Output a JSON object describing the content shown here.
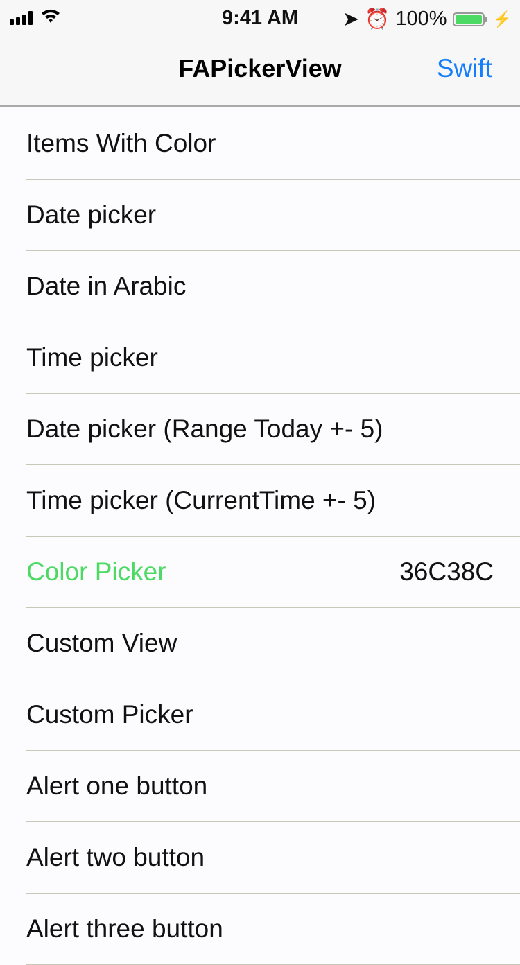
{
  "status_bar": {
    "time": "9:41 AM",
    "battery": "100%",
    "battery_level": 1.0,
    "icons": [
      "signal-icon",
      "wifi-icon",
      "location-icon",
      "alarm-icon",
      "battery-icon",
      "charging-icon"
    ]
  },
  "nav": {
    "title": "FAPickerView",
    "right_button": "Swift"
  },
  "colors": {
    "accent": "#147efb",
    "selected": "#4cd964"
  },
  "rows": [
    {
      "label": "Items With Color",
      "value": ""
    },
    {
      "label": "Date picker",
      "value": ""
    },
    {
      "label": "Date in Arabic",
      "value": ""
    },
    {
      "label": "Time picker",
      "value": ""
    },
    {
      "label": "Date picker (Range Today +- 5)",
      "value": ""
    },
    {
      "label": "Time picker (CurrentTime +- 5)",
      "value": ""
    },
    {
      "label": "Color Picker",
      "value": "36C38C"
    },
    {
      "label": "Custom View",
      "value": ""
    },
    {
      "label": "Custom Picker",
      "value": ""
    },
    {
      "label": "Alert one button",
      "value": ""
    },
    {
      "label": "Alert two button",
      "value": ""
    },
    {
      "label": "Alert three button",
      "value": ""
    }
  ]
}
